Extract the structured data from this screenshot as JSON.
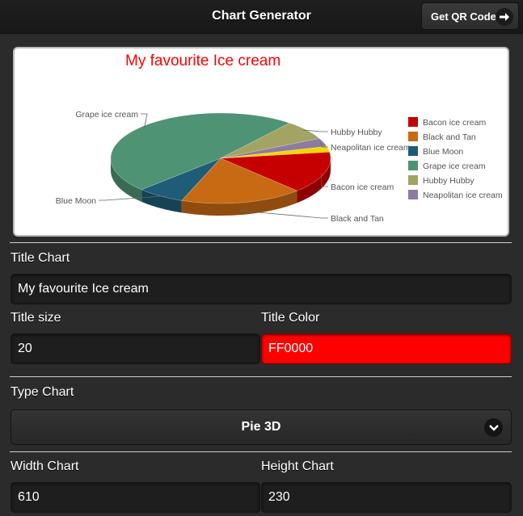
{
  "header": {
    "title": "Chart Generator",
    "qr_button_label": "Get QR Code",
    "qr_button_icon": "arrow-right-icon"
  },
  "chart_data": {
    "type": "pie",
    "variant": "3d",
    "title": "My favourite Ice cream",
    "title_color": "#FF0000",
    "legend_position": "right",
    "categories": [
      "Bacon ice cream",
      "Black and Tan",
      "Blue Moon",
      "Grape ice cream",
      "Hubby Hubby",
      "Neapolitan ice cream"
    ],
    "values": [
      15,
      18,
      7,
      48,
      7,
      3,
      2
    ],
    "colors": [
      "#C60000",
      "#C86A14",
      "#1E5C77",
      "#4E9374",
      "#A3A363",
      "#8E7BA0"
    ]
  },
  "form": {
    "title_chart_label": "Title Chart",
    "title_chart_value": "My favourite Ice cream",
    "title_size_label": "Title size",
    "title_size_value": "20",
    "title_color_label": "Title Color",
    "title_color_value": "FF0000",
    "type_chart_label": "Type Chart",
    "type_chart_value": "Pie 3D",
    "width_label": "Width Chart",
    "width_value": "610",
    "height_label": "Height Chart",
    "height_value": "230"
  },
  "colors": {
    "accent_red": "#FF0000",
    "background": "#2B2B2B"
  }
}
